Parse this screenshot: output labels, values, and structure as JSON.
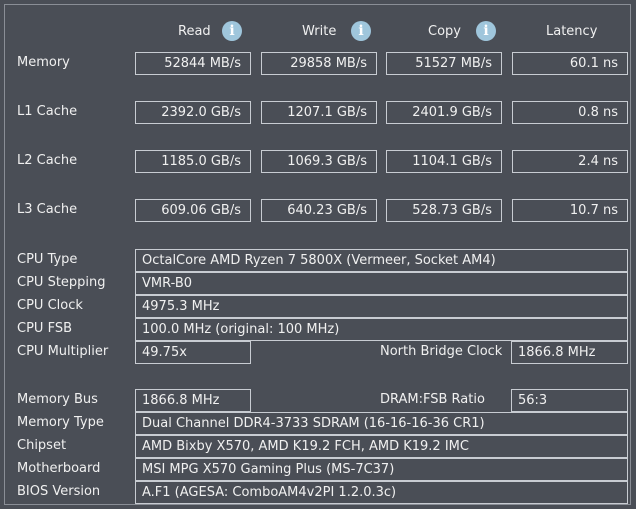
{
  "headers": {
    "read": "Read",
    "write": "Write",
    "copy": "Copy",
    "latency": "Latency"
  },
  "info_icon": "i",
  "bench": {
    "memory": {
      "label": "Memory",
      "read": "52844 MB/s",
      "write": "29858 MB/s",
      "copy": "51527 MB/s",
      "latency": "60.1 ns"
    },
    "l1": {
      "label": "L1 Cache",
      "read": "2392.0 GB/s",
      "write": "1207.1 GB/s",
      "copy": "2401.9 GB/s",
      "latency": "0.8 ns"
    },
    "l2": {
      "label": "L2 Cache",
      "read": "1185.0 GB/s",
      "write": "1069.3 GB/s",
      "copy": "1104.1 GB/s",
      "latency": "2.4 ns"
    },
    "l3": {
      "label": "L3 Cache",
      "read": "609.06 GB/s",
      "write": "640.23 GB/s",
      "copy": "528.73 GB/s",
      "latency": "10.7 ns"
    }
  },
  "cpu": {
    "type_label": "CPU Type",
    "type_value": "OctalCore AMD Ryzen 7 5800X  (Vermeer, Socket AM4)",
    "stepping_label": "CPU Stepping",
    "stepping_value": "VMR-B0",
    "clock_label": "CPU Clock",
    "clock_value": "4975.3 MHz",
    "fsb_label": "CPU FSB",
    "fsb_value": "100.0 MHz  (original: 100 MHz)",
    "multiplier_label": "CPU Multiplier",
    "multiplier_value": "49.75x",
    "nb_clock_label": "North Bridge Clock",
    "nb_clock_value": "1866.8 MHz"
  },
  "system": {
    "mem_bus_label": "Memory Bus",
    "mem_bus_value": "1866.8 MHz",
    "dram_fsb_label": "DRAM:FSB Ratio",
    "dram_fsb_value": "56:3",
    "mem_type_label": "Memory Type",
    "mem_type_value": "Dual Channel DDR4-3733 SDRAM  (16-16-16-36 CR1)",
    "chipset_label": "Chipset",
    "chipset_value": "AMD Bixby X570, AMD K19.2 FCH, AMD K19.2 IMC",
    "motherboard_label": "Motherboard",
    "motherboard_value": "MSI MPG X570 Gaming Plus (MS-7C37)",
    "bios_label": "BIOS Version",
    "bios_value": "A.F1  (AGESA: ComboAM4v2PI 1.2.0.3c)"
  },
  "colors": {
    "background": "#4a4e56",
    "box_border": "#c8ccd2",
    "info_icon": "#9fc6dc",
    "text": "#f0f0f0"
  }
}
